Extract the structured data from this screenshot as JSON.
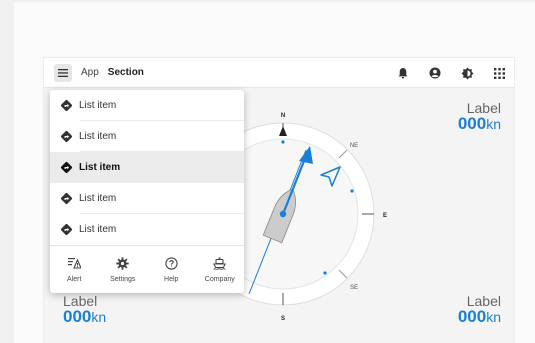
{
  "topbar": {
    "app": "App",
    "section": "Section",
    "icons": [
      "bell-icon",
      "account-icon",
      "brightness-icon",
      "apps-grid-icon"
    ]
  },
  "compass": {
    "north": "N",
    "northeast": "NE",
    "east": "E",
    "southeast": "SE",
    "south": "S"
  },
  "readouts": {
    "top_right": {
      "label": "Label",
      "value": "000",
      "unit": "kn"
    },
    "bottom_left": {
      "label": "Label",
      "value": "000",
      "unit": "kn"
    },
    "bottom_right": {
      "label": "Label",
      "value": "000",
      "unit": "kn"
    }
  },
  "menu": {
    "items": [
      {
        "label": "List item",
        "selected": false
      },
      {
        "label": "List item",
        "selected": false
      },
      {
        "label": "List item",
        "selected": true
      },
      {
        "label": "List item",
        "selected": false
      },
      {
        "label": "List item",
        "selected": false
      }
    ],
    "bottom": [
      {
        "label": "Alert",
        "icon": "alert-list-icon"
      },
      {
        "label": "Settings",
        "icon": "gear-icon"
      },
      {
        "label": "Help",
        "icon": "help-icon"
      },
      {
        "label": "Company",
        "icon": "ship-icon"
      }
    ]
  },
  "colors": {
    "accent": "#1a7fd6",
    "selected_bg": "#ebebeb",
    "topbar_bg": "#ffffff"
  }
}
